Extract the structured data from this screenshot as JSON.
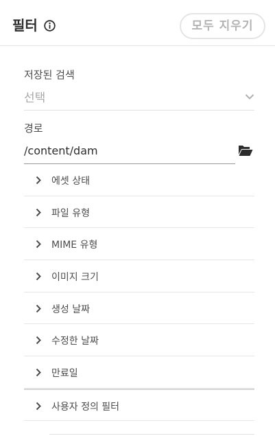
{
  "header": {
    "title": "필터",
    "clear_all_label": "모두 지우기"
  },
  "saved_search": {
    "label": "저장된 검색",
    "value": "선택"
  },
  "path": {
    "label": "경로",
    "value": "/content/dam"
  },
  "filters": [
    {
      "label": "에셋 상태"
    },
    {
      "label": "파일 유형"
    },
    {
      "label": "MIME 유형"
    },
    {
      "label": "이미지 크기"
    },
    {
      "label": "생성 날짜"
    },
    {
      "label": "수정한 날짜"
    },
    {
      "label": "만료일"
    },
    {
      "label": "사용자 정의 필터"
    }
  ],
  "icons": {
    "info": "info-icon",
    "dropdown": "chevron-down-icon",
    "folder": "folder-open-icon",
    "expand": "chevron-right-icon"
  }
}
